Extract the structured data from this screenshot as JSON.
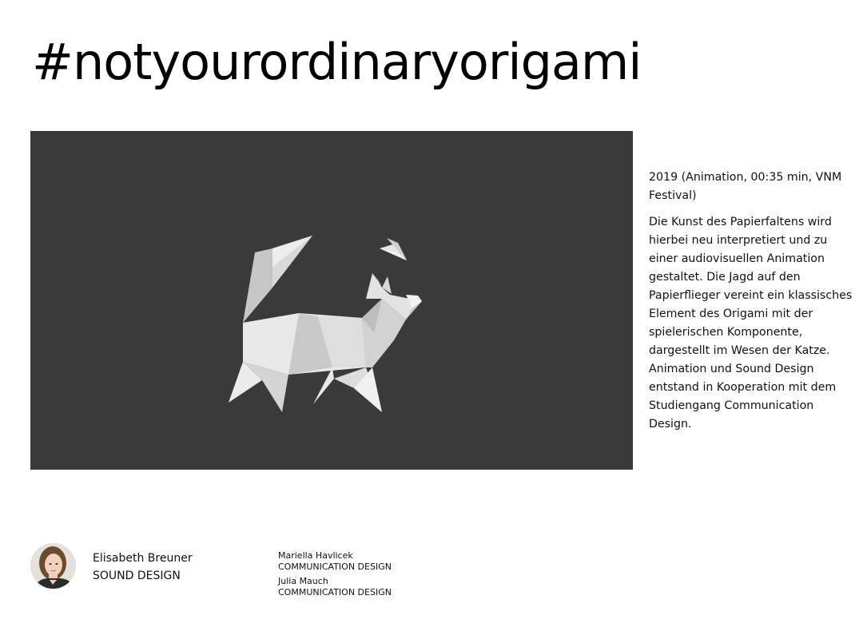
{
  "title": "#notyourordinaryorigami",
  "video": {
    "background": "#3a3a3a",
    "artwork": "origami-cat-chasing-paper-plane"
  },
  "side": {
    "meta": "2019 (Animation, 00:35 min, VNM Festival)",
    "description": "Die Kunst des Papierfaltens wird hierbei neu interpretiert und zu einer audiovisuellen Animation gestaltet. Die Jagd auf den Papierflieger vereint ein klassisches Element des Origami mit der spielerischen Komponente, dargestellt im Wesen der Katze. Animation und Sound Design entstand in Kooperation mit dem Studiengang Communication Design."
  },
  "credits": {
    "main": {
      "name": "Elisabeth Breuner",
      "role": "SOUND DESIGN"
    },
    "others": [
      {
        "name": "Mariella Havlicek",
        "role": "COMMUNICATION DESIGN"
      },
      {
        "name": "Julia Mauch",
        "role": "COMMUNICATION DESIGN"
      }
    ]
  }
}
